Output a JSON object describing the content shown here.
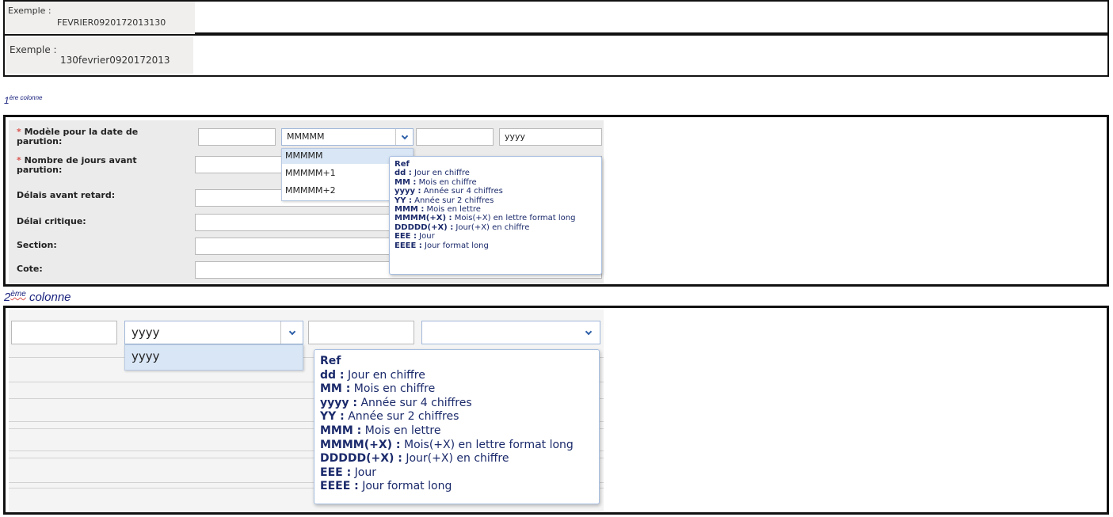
{
  "examples": [
    {
      "label": "Exemple :",
      "value": "FEVRIER0920172013130"
    },
    {
      "label": "Exemple :",
      "value": "130fevrier0920172013"
    }
  ],
  "caption1": {
    "num": "1",
    "sup": "ère colonne"
  },
  "caption2": {
    "num": "2",
    "sup": "ème",
    "text": "colonne"
  },
  "form": {
    "fields": [
      {
        "label": "Modèle pour la date de parution:",
        "required": true
      },
      {
        "label": "Nombre de jours avant parution:",
        "required": true
      },
      {
        "label": "Délais avant retard:",
        "required": false
      },
      {
        "label": "Délai critique:",
        "required": false
      },
      {
        "label": "Section:",
        "required": false
      },
      {
        "label": "Cote:",
        "required": false
      }
    ],
    "month_select": "MMMMM",
    "year_input": "yyyy",
    "month_options": [
      "MMMMM",
      "MMMMM+1",
      "MMMMM+2"
    ]
  },
  "col2": {
    "year_select": "yyyy",
    "year_options": [
      "yyyy"
    ]
  },
  "ref_tooltip": {
    "title": "Ref",
    "rows": [
      {
        "key": "dd :",
        "desc": "Jour en chiffre"
      },
      {
        "key": "MM :",
        "desc": "Mois en chiffre"
      },
      {
        "key": "yyyy :",
        "desc": "Année sur 4 chiffres"
      },
      {
        "key": "YY :",
        "desc": "Année sur 2 chiffres"
      },
      {
        "key": "MMM :",
        "desc": "Mois en lettre"
      },
      {
        "key": "MMMM(+X) :",
        "desc": "Mois(+X) en lettre format long"
      },
      {
        "key": "DDDDD(+X) :",
        "desc": "Jour(+X) en chiffre"
      },
      {
        "key": "EEE :",
        "desc": "Jour"
      },
      {
        "key": "EEEE :",
        "desc": "Jour format long"
      }
    ]
  },
  "colors": {
    "required": "#d9534f",
    "tooltip_text": "#1b2a6b",
    "caption": "#1a237e"
  }
}
